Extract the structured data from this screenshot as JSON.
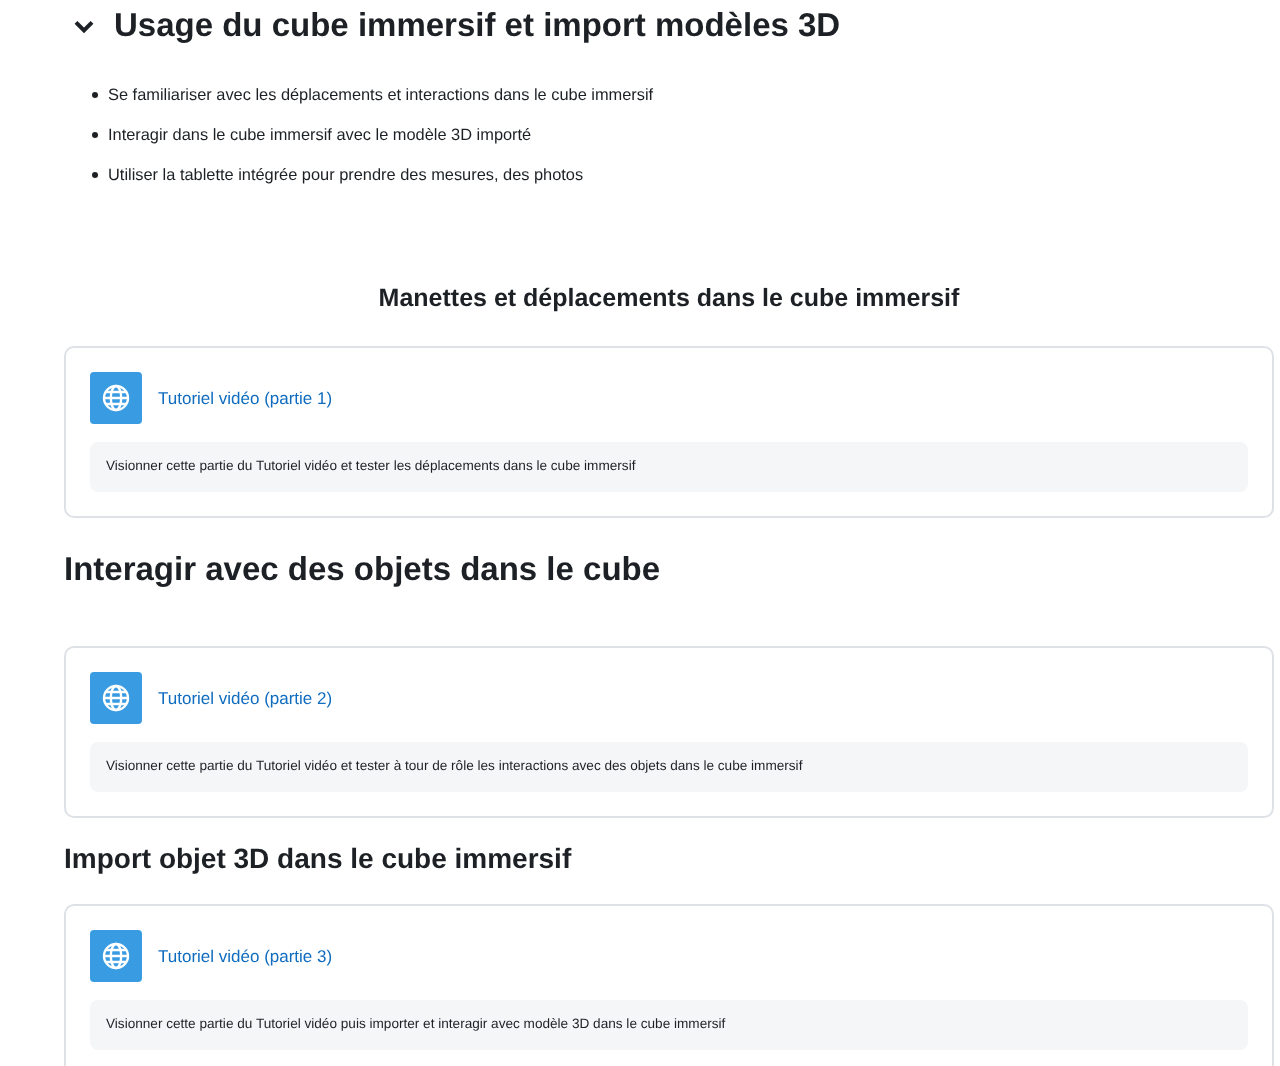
{
  "section": {
    "title": "Usage du cube immersif et import modèles 3D",
    "expanded": true,
    "objectives": [
      "Se familiariser avec les déplacements et interactions dans le cube immersif",
      "Interagir dans le cube immersif avec le modèle 3D importé",
      "Utiliser la tablette intégrée pour prendre des mesures, des photos"
    ],
    "blocks": [
      {
        "heading": "Manettes et déplacements dans le cube immersif",
        "kind": "centered",
        "activity": {
          "link": "Tutoriel vidéo (partie 1)",
          "description": "Visionner cette partie du Tutoriel vidéo et tester les déplacements dans le cube immersif"
        }
      },
      {
        "heading": "Interagir avec des objets dans le cube",
        "kind": "large",
        "activity": {
          "link": "Tutoriel vidéo (partie 2)",
          "description": "Visionner cette partie du Tutoriel vidéo et tester à tour de rôle les interactions avec des objets dans le cube immersif"
        }
      },
      {
        "heading": "Import objet 3D dans le cube immersif",
        "kind": "medium",
        "activity": {
          "link": "Tutoriel vidéo (partie 3)",
          "description": "Visionner cette partie du Tutoriel vidéo puis importer et interagir avec modèle 3D  dans le cube immersif"
        }
      }
    ]
  }
}
